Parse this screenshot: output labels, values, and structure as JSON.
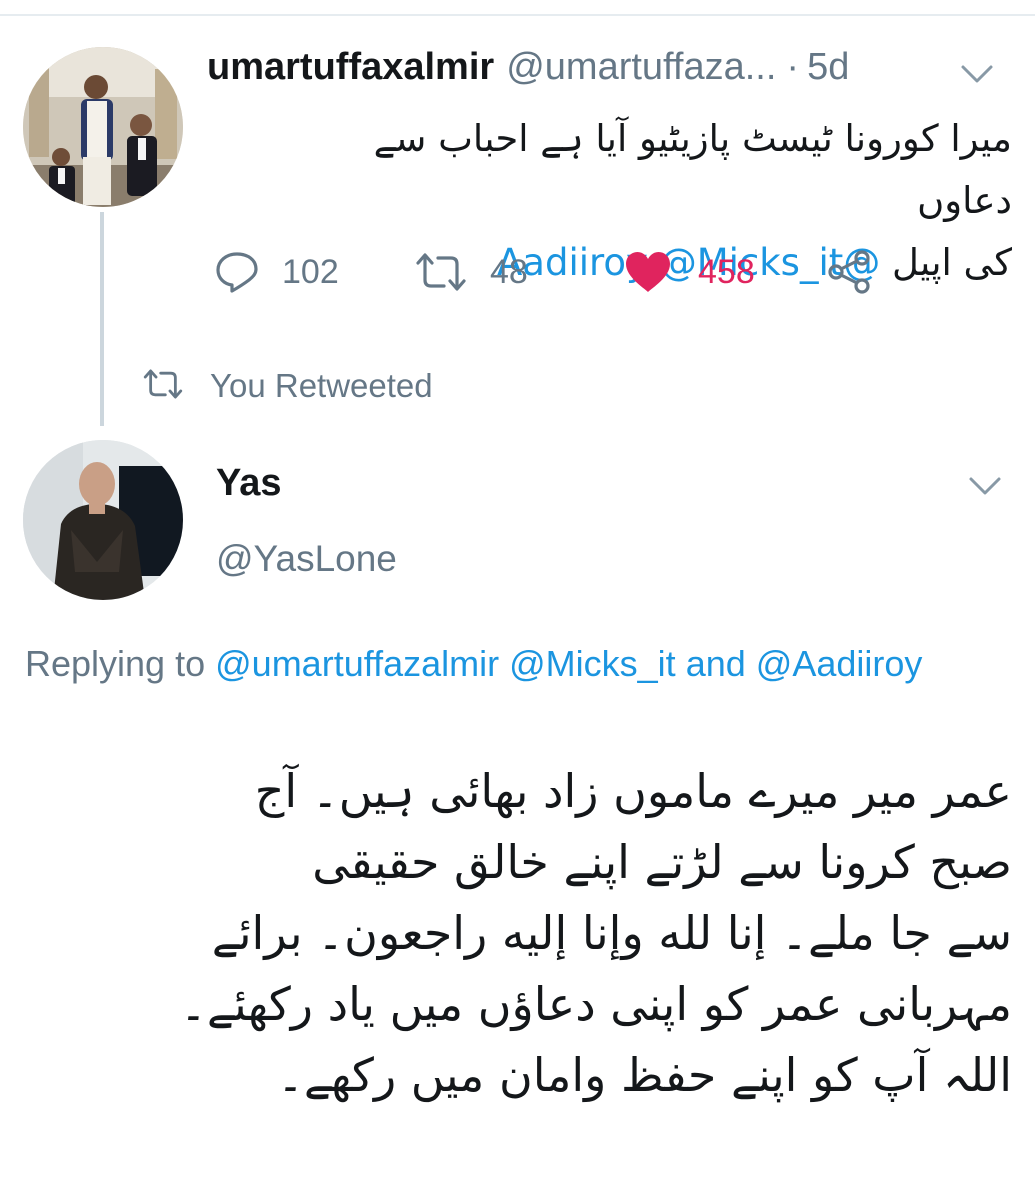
{
  "tweet": {
    "display_name": "umartuffaxalmir",
    "handle": "@umartuffaza...",
    "separator": "·",
    "time": "5d",
    "text_urdu_line1": "میرا کورونا ٹیسٹ پازیٹیو آیا ہے احباب سے دعاوں",
    "text_urdu_line2": "کی اپیل",
    "mentions": [
      "@Micks_it",
      "@Aadiiroy"
    ],
    "counts": {
      "replies": "102",
      "retweets": "48",
      "likes": "458"
    }
  },
  "retweet_notice": "You Retweeted",
  "reply": {
    "display_name": "Yas",
    "handle": "@YasLone",
    "replying_prefix": "Replying to",
    "replying_to": [
      "@umartuffazalmir",
      "@Micks_it"
    ],
    "replying_and": "and",
    "replying_last": "@Aadiiroy",
    "text_lines": [
      "عمر میر میرے ماموں زاد بھائی ہیں۔ آج",
      "صبح کرونا سے لڑتے اپنے خالق حقیقی",
      "سے جا ملے۔ إنا لله وإنا إليه راجعون۔ برائے",
      "مہربانی عمر کو اپنی دعاؤں میں یاد رکھئے۔",
      "اللہ آپ کو اپنے حفظ وامان میں رکھے۔"
    ]
  },
  "icons": {
    "reply": "reply-icon",
    "retweet": "retweet-icon",
    "like": "heart-icon",
    "share": "share-icon",
    "menu": "chevron-down-icon"
  },
  "colors": {
    "accent": "#1b95e0",
    "like": "#e0245e",
    "muted": "#657786",
    "thread_line": "#ccd6dd"
  }
}
